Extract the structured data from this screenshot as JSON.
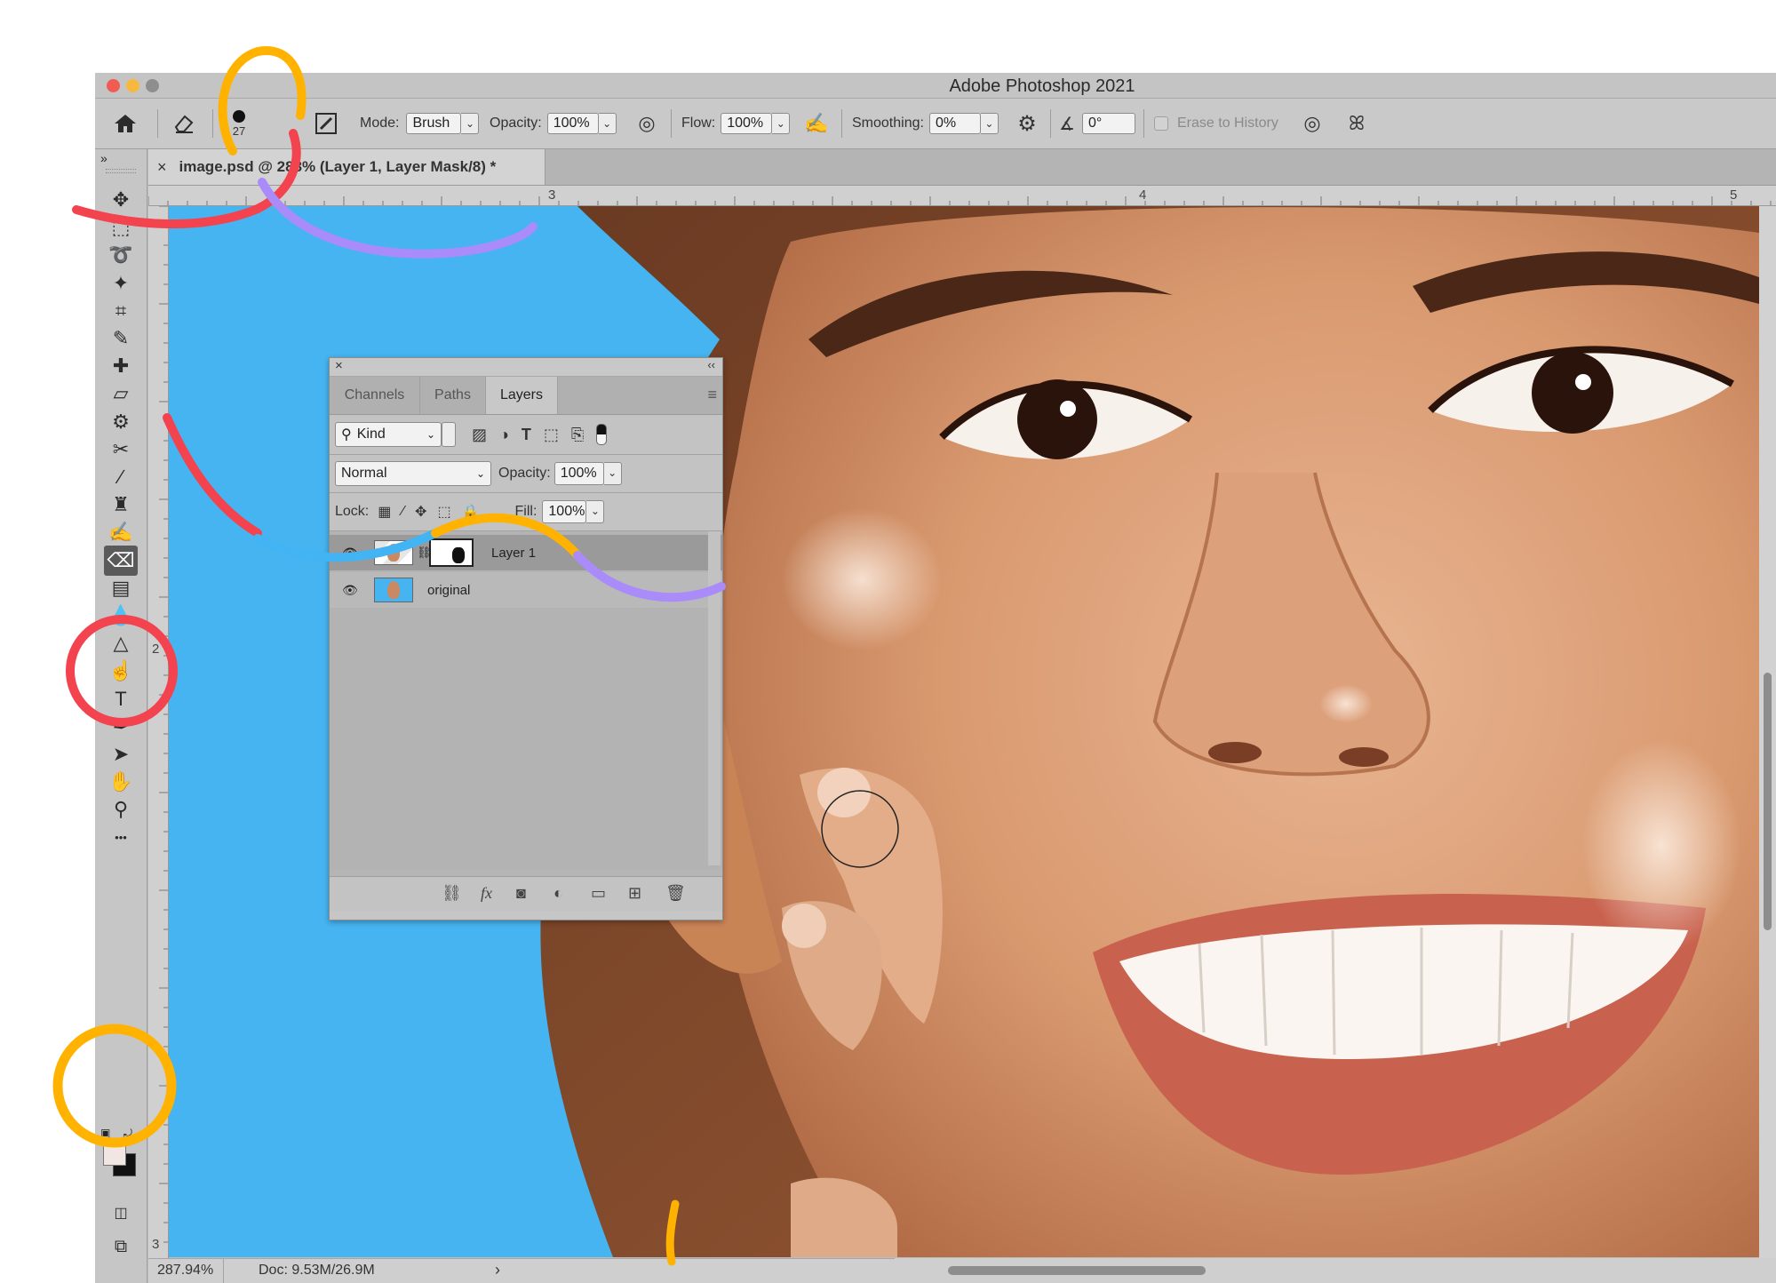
{
  "window": {
    "title": "Adobe Photoshop 2021",
    "traffic_colors": [
      "#f25b54",
      "#f6b93c",
      "#8e8e8e"
    ]
  },
  "options_bar": {
    "brush_size": "27",
    "mode_label": "Mode:",
    "mode_value": "Brush",
    "opacity_label": "Opacity:",
    "opacity_value": "100%",
    "flow_label": "Flow:",
    "flow_value": "100%",
    "smoothing_label": "Smoothing:",
    "smoothing_value": "0%",
    "angle_value": "0°",
    "erase_history_label": "Erase to History"
  },
  "document_tab": {
    "close": "×",
    "title": "image.psd @ 288% (Layer 1, Layer Mask/8) *"
  },
  "rulers": {
    "top_labels": [
      "3",
      "4",
      "5"
    ],
    "left_labels": [
      "2",
      "3"
    ]
  },
  "toolbox": {
    "collapse": "»",
    "tools": [
      {
        "name": "move-tool-icon",
        "glyph": "✥"
      },
      {
        "name": "marquee-tool-icon",
        "glyph": "⬚"
      },
      {
        "name": "lasso-tool-icon",
        "glyph": "➰"
      },
      {
        "name": "magic-wand-tool-icon",
        "glyph": "✦"
      },
      {
        "name": "crop-tool-icon",
        "glyph": "⌗"
      },
      {
        "name": "eyedropper-tool-icon",
        "glyph": "✎"
      },
      {
        "name": "spot-healing-tool-icon",
        "glyph": "✚"
      },
      {
        "name": "healing-brush-tool-icon",
        "glyph": "▱"
      },
      {
        "name": "patch-tool-icon",
        "glyph": "⚙"
      },
      {
        "name": "content-aware-move-tool-icon",
        "glyph": "✂"
      },
      {
        "name": "brush-tool-icon",
        "glyph": "∕"
      },
      {
        "name": "clone-stamp-tool-icon",
        "glyph": "♜"
      },
      {
        "name": "history-brush-tool-icon",
        "glyph": "✍"
      },
      {
        "name": "eraser-tool-icon",
        "glyph": "⌫"
      },
      {
        "name": "gradient-tool-icon",
        "glyph": "▤"
      },
      {
        "name": "blur-tool-icon",
        "glyph": "💧"
      },
      {
        "name": "sharpen-tool-icon",
        "glyph": "△"
      },
      {
        "name": "smudge-tool-icon",
        "glyph": "☝"
      },
      {
        "name": "type-tool-icon",
        "glyph": "T"
      },
      {
        "name": "pen-tool-icon",
        "glyph": "✒"
      },
      {
        "name": "path-selection-tool-icon",
        "glyph": "➤"
      },
      {
        "name": "hand-tool-icon",
        "glyph": "✋"
      },
      {
        "name": "zoom-tool-icon",
        "glyph": "⚲"
      },
      {
        "name": "more-tools-icon",
        "glyph": "•••"
      }
    ],
    "active_tool": "eraser-tool-icon",
    "foreground_color": "#f1e6e1",
    "background_color": "#111111"
  },
  "layers_panel": {
    "tabs": [
      "Channels",
      "Paths",
      "Layers"
    ],
    "active_tab": "Layers",
    "filter_kind": "Kind",
    "blend_mode": "Normal",
    "opacity_label": "Opacity:",
    "opacity_value": "100%",
    "lock_label": "Lock:",
    "fill_label": "Fill:",
    "fill_value": "100%",
    "layers": [
      {
        "name": "Layer 1",
        "visible": true,
        "selected": true,
        "has_mask": true
      },
      {
        "name": "original",
        "visible": true,
        "selected": false,
        "has_mask": false
      }
    ],
    "bottom_icons": [
      "link-icon",
      "fx-icon",
      "mask-icon",
      "adjustment-icon",
      "folder-icon",
      "new-layer-icon",
      "trash-icon"
    ]
  },
  "status_bar": {
    "zoom": "287.94%",
    "doc": "Doc: 9.53M/26.9M",
    "arrow": "›"
  },
  "annotation_colors": {
    "red": "#f2434f",
    "orange": "#ffb300",
    "purple": "#a98cfa",
    "blue": "#42b4f4"
  }
}
